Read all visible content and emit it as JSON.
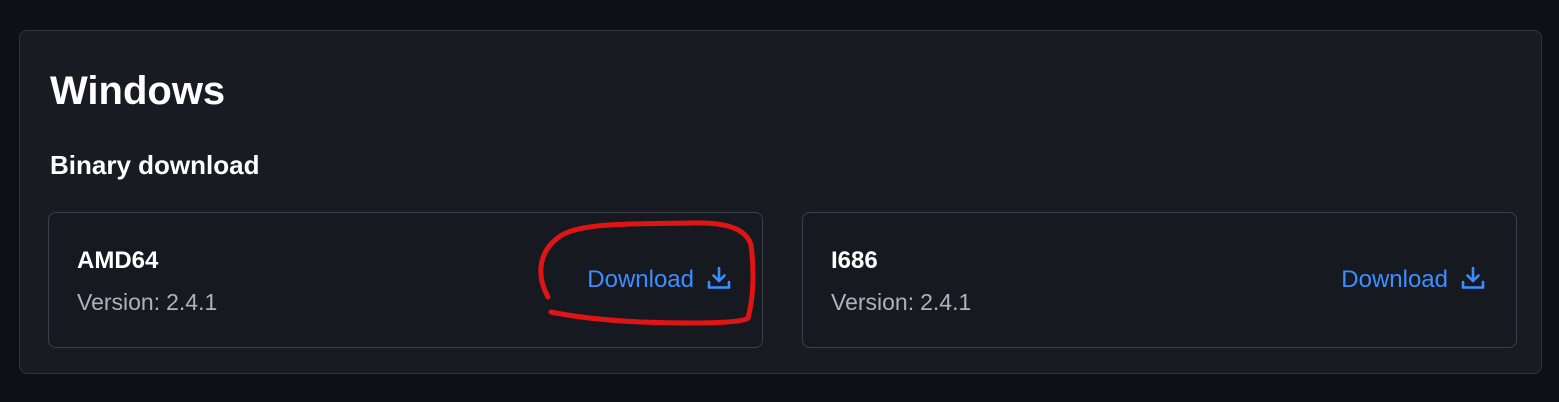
{
  "section": {
    "title": "Windows",
    "subtitle": "Binary download"
  },
  "builds": [
    {
      "arch": "AMD64",
      "version_label": "Version:",
      "version": "2.4.1",
      "download_label": "Download",
      "icon": "download-icon"
    },
    {
      "arch": "I686",
      "version_label": "Version:",
      "version": "2.4.1",
      "download_label": "Download",
      "icon": "download-icon"
    }
  ],
  "colors": {
    "page_background": "#0d1014",
    "panel_background": "#181b22",
    "card_background": "#161a20",
    "link": "#3b8eff",
    "annotation": "#e01414"
  }
}
